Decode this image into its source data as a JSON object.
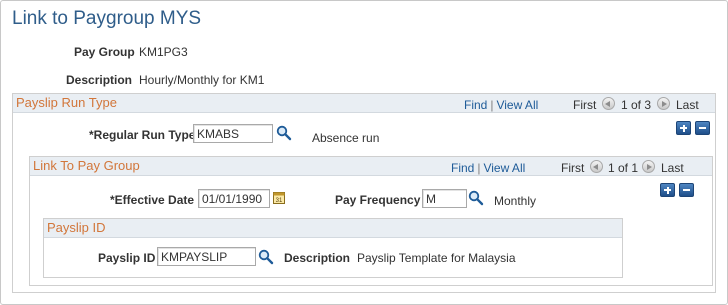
{
  "page": {
    "title": "Link to Paygroup MYS"
  },
  "header": {
    "pay_group_label": "Pay Group",
    "pay_group_value": "KM1PG3",
    "description_label": "Description",
    "description_value": "Hourly/Monthly for KM1"
  },
  "payslip_run_type": {
    "title": "Payslip Run Type",
    "nav": {
      "find": "Find",
      "separator": "|",
      "view_all": "View All",
      "first": "First",
      "position": "1 of 3",
      "last": "Last"
    },
    "regular_run_type_label": "*Regular Run Type",
    "regular_run_type_value": "KMABS",
    "regular_run_type_description": "Absence run"
  },
  "link_to_pay_group": {
    "title": "Link To Pay Group",
    "nav": {
      "find": "Find",
      "separator": "|",
      "view_all": "View All",
      "first": "First",
      "position": "1 of 1",
      "last": "Last"
    },
    "effective_date_label": "*Effective Date",
    "effective_date_value": "01/01/1990",
    "pay_frequency_label": "Pay Frequency",
    "pay_frequency_value": "M",
    "pay_frequency_description": "Monthly"
  },
  "payslip_id": {
    "title": "Payslip ID",
    "payslip_id_label": "Payslip ID",
    "payslip_id_value": "KMPAYSLIP",
    "description_label": "Description",
    "description_value": "Payslip Template for Malaysia"
  },
  "icons": {
    "lookup": "magnifier-icon",
    "calendar": "calendar-icon",
    "add_row": "plus-icon",
    "delete_row": "minus-icon",
    "previous": "arrow-left-icon",
    "next": "arrow-right-icon"
  },
  "colors": {
    "title": "#2f5d8a",
    "section_title": "#d2763a",
    "link": "#1e5b98",
    "section_header_bg": "#e9eef3",
    "row_button": "#2c5f9e"
  }
}
